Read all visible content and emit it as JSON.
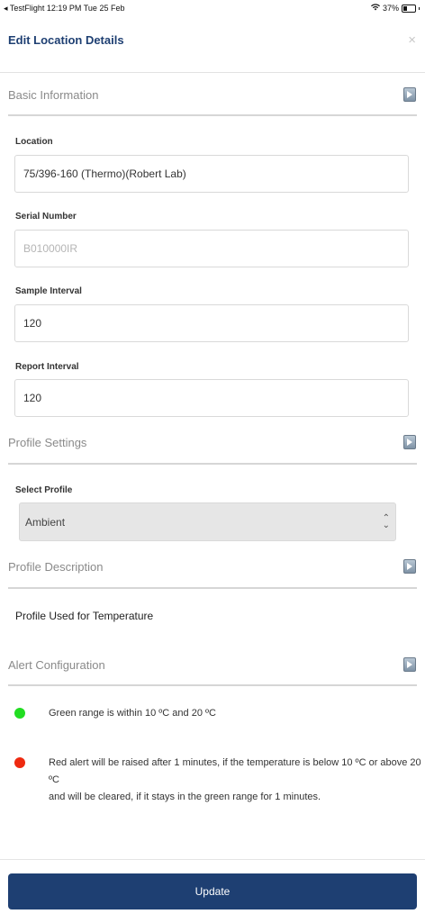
{
  "status_bar": {
    "app": "◂ TestFlight",
    "time": "12:19 PM",
    "date": "Tue 25 Feb",
    "battery": "37%"
  },
  "header": {
    "title": "Edit Location Details",
    "close": "×"
  },
  "sections": {
    "basic": "Basic Information",
    "profile_settings": "Profile Settings",
    "profile_description": "Profile Description",
    "alert_configuration": "Alert Configuration"
  },
  "basic": {
    "location_label": "Location",
    "location_value": "75/396-160 (Thermo)(Robert Lab)",
    "serial_label": "Serial Number",
    "serial_value": "B010000IR",
    "sample_label": "Sample Interval",
    "sample_value": "120",
    "report_label": "Report Interval",
    "report_value": "120"
  },
  "profile": {
    "select_label": "Select Profile",
    "selected": "Ambient",
    "description": "Profile Used for Temperature"
  },
  "alerts": {
    "green_color": "#22dd22",
    "red_color": "#ee2a10",
    "green_text": "Green range is within 10 ºC and 20 ºC",
    "red_text_line1": "Red alert will be raised after 1 minutes, if the temperature is below 10 ºC or above 20 ºC",
    "red_text_line2": "and will be cleared, if it stays in the green range for 1 minutes."
  },
  "actions": {
    "update": "Update"
  }
}
